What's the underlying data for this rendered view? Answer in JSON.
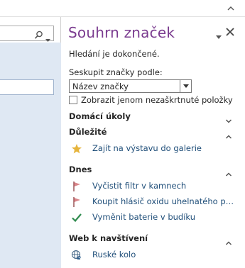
{
  "pane": {
    "title": "Souhrn značek",
    "status": "Hledání je dokončené.",
    "group_label": "Seskupit značky podle:",
    "group_selected": "Název značky",
    "checkbox_label": "Zobrazit jenom nezaškrtnuté položky",
    "checkbox_checked": false
  },
  "sections": [
    {
      "name": "Domácí úkoly",
      "expanded": false,
      "items": []
    },
    {
      "name": "Důležité",
      "expanded": true,
      "items": [
        {
          "icon": "star-icon",
          "text": "Zajít na výstavu do galerie"
        }
      ]
    },
    {
      "name": "Dnes",
      "expanded": true,
      "items": [
        {
          "icon": "flag-icon",
          "text": "Vyčistit filtr v kamnech"
        },
        {
          "icon": "flag-icon",
          "text": "Koupit hlásič oxidu uhelnatého pro ..."
        },
        {
          "icon": "checkmark-icon",
          "text": "Vyměnit baterie v budíku"
        }
      ]
    },
    {
      "name": "Web k navštívení",
      "expanded": true,
      "items": [
        {
          "icon": "globe-link-icon",
          "text": "Ruské kolo"
        }
      ]
    }
  ],
  "colors": {
    "title": "#7a3b8f",
    "link": "#1f4e79",
    "star": "#e6b43c",
    "flag": "#d9868a",
    "check": "#2f8b4e",
    "side_band": "#dfe8f3"
  }
}
